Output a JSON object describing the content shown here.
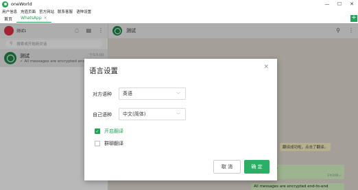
{
  "app": {
    "title": "oneWorld"
  },
  "window_controls": {
    "minimize": "—",
    "maximize": "☐",
    "close": "✕"
  },
  "menu": [
    "用户信息",
    "充值页面",
    "官方网站",
    "联系客服",
    "语种设置"
  ],
  "tabs": [
    {
      "label": "首页",
      "active": false
    },
    {
      "label": "WhatsApp",
      "active": true,
      "close": "×"
    }
  ],
  "add_tab": "+",
  "left": {
    "my_name": "测试1",
    "search_placeholder": "搜索或开始新对话",
    "chats": [
      {
        "name": "测试",
        "preview": "✓ All messages are encrypted end-to-end",
        "time": "下午3:00"
      }
    ]
  },
  "conversation": {
    "contact_name": "测试",
    "messages": [
      {
        "text": "翻译成功啦，点击了翻译。",
        "type": "system"
      },
      {
        "text": "ly all over the world without restriction",
        "sub": "翻译成功啦，点击了翻译的译文后可以看到原文",
        "time": "下午3:00 ✓",
        "type": "out"
      },
      {
        "text": "All messages are encrypted end-to-end",
        "type": "out"
      }
    ]
  },
  "dialog": {
    "title": "语言设置",
    "close": "×",
    "target_lang_label": "对方语种",
    "target_lang_value": "英语",
    "own_lang_label": "自己语种",
    "own_lang_value": "中文(简体)",
    "enable_translate_label": "开启翻译",
    "enable_translate_checked": true,
    "group_translate_label": "群聊翻译",
    "group_translate_checked": false,
    "cancel_label": "取 消",
    "ok_label": "确 定"
  },
  "colors": {
    "brand": "#22a35a",
    "chat_bg": "#e5ddd5",
    "bubble_out": "#dcf8c6"
  }
}
